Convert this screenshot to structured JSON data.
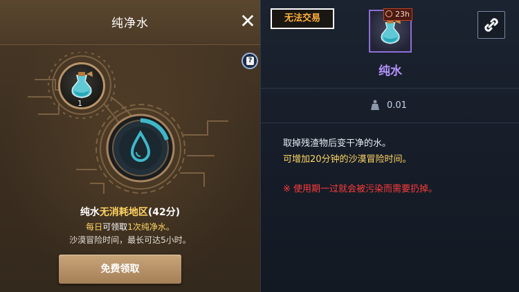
{
  "left_panel": {
    "title": "纯净水",
    "close_symbol": "✕",
    "help_icon": "help-book-icon",
    "item_count": "1",
    "name_part1": "纯水",
    "name_highlight": "无消耗地区",
    "name_part2": "(42分)",
    "desc_line1_prefix": "每日",
    "desc_line1_highlight": "可领取",
    "desc_line1_suffix": "1次纯净水。",
    "desc_line2": "沙漠冒险时间，最长可达5小时。",
    "claim_button": "免费领取"
  },
  "right_panel": {
    "trade_badge": "无法交易",
    "timer": "23h",
    "item_name": "纯水",
    "weight": "0.01",
    "desc_line1": "取掉残渣物后变干净的水。",
    "desc_line2": "可增加20分钟的沙漠冒险时间。",
    "warning": "※ 使用期一过就会被污染而需要扔掉。",
    "link_icon": "link-icon"
  },
  "colors": {
    "highlight_gold": "#ffd463",
    "item_purple": "#b592ff",
    "warning_red": "#ff3b3b",
    "trade_orange": "#ffb03b"
  }
}
